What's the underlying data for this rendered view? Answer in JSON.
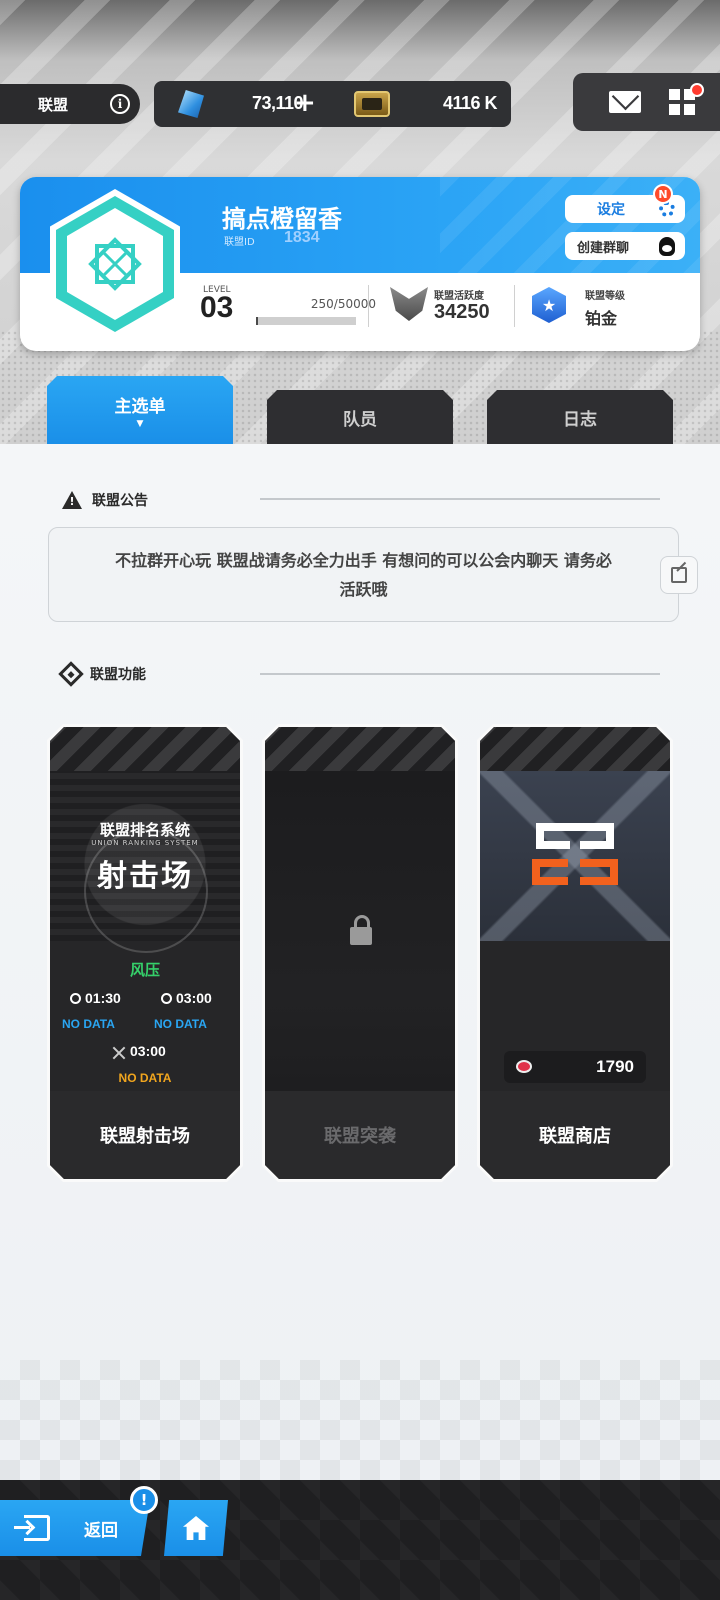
{
  "header": {
    "title": "联盟",
    "gems": "73,110",
    "plus_icon": "plus-icon",
    "credits": "4116 K",
    "icons": [
      "info-icon",
      "gem-icon",
      "card-icon",
      "mail-icon",
      "grid-menu-icon"
    ]
  },
  "union": {
    "name": "搞点橙留香",
    "id_label": "联盟ID",
    "id": "1834",
    "settings_label": "设定",
    "new_badge": "N",
    "group_chat_label": "创建群聊",
    "level_label": "LEVEL",
    "level": "03",
    "exp_text": "250/50000",
    "exp_fraction": 0.005,
    "activity_label": "联盟活跃度",
    "activity": "34250",
    "rank_label": "联盟等级",
    "rank": "铂金",
    "emblem_color": "#35d0c4"
  },
  "tabs": [
    {
      "label": "主选单",
      "active": true
    },
    {
      "label": "队员",
      "active": false
    },
    {
      "label": "日志",
      "active": false
    }
  ],
  "notice": {
    "heading": "联盟公告",
    "text": "不拉群开心玩 联盟战请务必全力出手 有想问的可以公会内聊天 请务必活跃哦"
  },
  "functions": {
    "heading": "联盟功能",
    "range": {
      "subtitle": "联盟排名系统",
      "subtitle_en": "UNION RANKING SYSTEM",
      "main": "射击场",
      "wind": "风压",
      "timer1": "01:30",
      "timer2": "03:00",
      "nodata1": "NO DATA",
      "nodata2": "NO DATA",
      "timer3": "03:00",
      "nodata3": "NO DATA",
      "title": "联盟射击场"
    },
    "raid": {
      "title": "联盟突袭",
      "locked": true
    },
    "shop": {
      "price": "1790",
      "title": "联盟商店"
    }
  },
  "footer": {
    "back_label": "返回",
    "alert": "!"
  },
  "colors": {
    "accent_blue": "#1a8fe8",
    "wind_green": "#35d06a",
    "nodata_blue": "#2aa6f3",
    "nodata_orange": "#f0a51e",
    "shop_orange": "#f2611d"
  }
}
